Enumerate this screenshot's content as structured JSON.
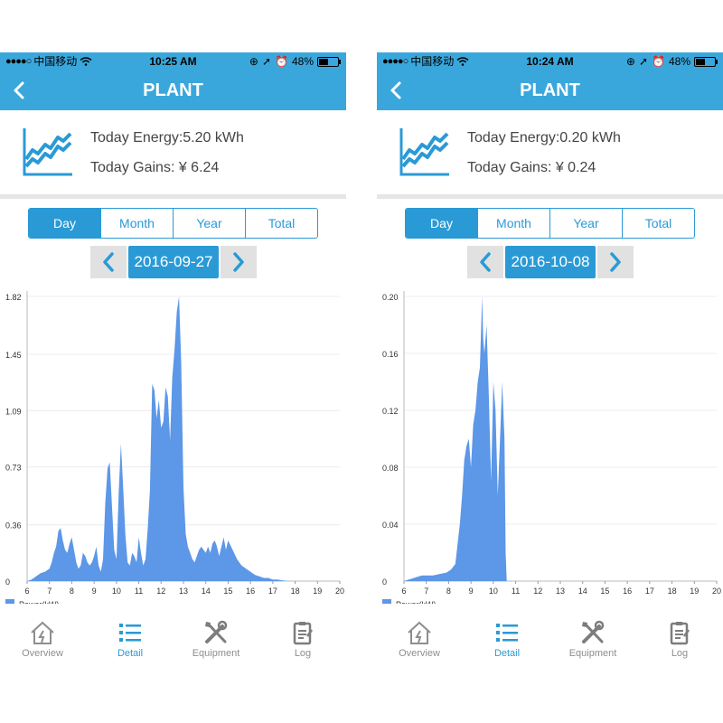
{
  "screens": [
    {
      "status": {
        "carrier": "中国移动",
        "time": "10:25 AM",
        "battery": "48%"
      },
      "nav": {
        "title": "PLANT"
      },
      "summary": {
        "energy": "Today Energy:5.20 kWh",
        "gains": "Today Gains: ¥ 6.24"
      },
      "segments": [
        "Day",
        "Month",
        "Year",
        "Total"
      ],
      "active_segment": 0,
      "date": "2016-09-27",
      "tabs": [
        "Overview",
        "Detail",
        "Equipment",
        "Log"
      ],
      "active_tab": 1
    },
    {
      "status": {
        "carrier": "中国移动",
        "time": "10:24 AM",
        "battery": "48%"
      },
      "nav": {
        "title": "PLANT"
      },
      "summary": {
        "energy": "Today Energy:0.20 kWh",
        "gains": "Today Gains: ¥ 0.24"
      },
      "segments": [
        "Day",
        "Month",
        "Year",
        "Total"
      ],
      "active_segment": 0,
      "date": "2016-10-08",
      "tabs": [
        "Overview",
        "Detail",
        "Equipment",
        "Log"
      ],
      "active_tab": 1
    }
  ],
  "colors": {
    "accent": "#2a9ad6",
    "header": "#3aa7dc",
    "series": "#5c97e8"
  },
  "chart_data": [
    {
      "type": "area",
      "xlabel": "",
      "ylabel": "",
      "x_ticks": [
        "6",
        "7",
        "8",
        "9",
        "10",
        "11",
        "12",
        "13",
        "14",
        "15",
        "16",
        "17",
        "18",
        "19",
        "20"
      ],
      "xlim": [
        6,
        20
      ],
      "y_ticks": [
        "0",
        "0.36",
        "0.73",
        "1.09",
        "1.45",
        "1.82"
      ],
      "ylim": [
        0,
        1.82
      ],
      "series": [
        {
          "name": "Power(kW)",
          "x": [
            6.0,
            6.2,
            6.4,
            6.6,
            6.8,
            7.0,
            7.1,
            7.2,
            7.3,
            7.4,
            7.5,
            7.6,
            7.7,
            7.8,
            7.9,
            8.0,
            8.1,
            8.2,
            8.3,
            8.4,
            8.5,
            8.6,
            8.7,
            8.8,
            8.9,
            9.0,
            9.1,
            9.2,
            9.3,
            9.4,
            9.5,
            9.6,
            9.7,
            9.8,
            9.9,
            10.0,
            10.1,
            10.2,
            10.3,
            10.4,
            10.5,
            10.6,
            10.7,
            10.8,
            10.9,
            11.0,
            11.1,
            11.2,
            11.3,
            11.4,
            11.5,
            11.6,
            11.7,
            11.8,
            11.9,
            12.0,
            12.1,
            12.2,
            12.3,
            12.4,
            12.5,
            12.6,
            12.7,
            12.8,
            12.9,
            13.0,
            13.1,
            13.2,
            13.3,
            13.4,
            13.5,
            13.6,
            13.7,
            13.8,
            13.9,
            14.0,
            14.1,
            14.2,
            14.3,
            14.4,
            14.5,
            14.6,
            14.7,
            14.8,
            14.9,
            15.0,
            15.2,
            15.4,
            15.6,
            15.8,
            16.0,
            16.2,
            16.4,
            16.6,
            16.8,
            17.0,
            17.2,
            17.4,
            17.6,
            17.8,
            18.0,
            18.5,
            19.0,
            19.5,
            20.0
          ],
          "y": [
            0,
            0.01,
            0.03,
            0.05,
            0.06,
            0.08,
            0.12,
            0.18,
            0.22,
            0.32,
            0.34,
            0.26,
            0.2,
            0.18,
            0.24,
            0.28,
            0.2,
            0.12,
            0.08,
            0.1,
            0.18,
            0.16,
            0.12,
            0.1,
            0.12,
            0.16,
            0.22,
            0.1,
            0.06,
            0.14,
            0.5,
            0.72,
            0.76,
            0.48,
            0.2,
            0.14,
            0.56,
            0.88,
            0.6,
            0.3,
            0.12,
            0.1,
            0.18,
            0.16,
            0.12,
            0.28,
            0.18,
            0.1,
            0.14,
            0.34,
            0.58,
            1.26,
            1.22,
            1.04,
            1.16,
            0.98,
            1.02,
            1.24,
            1.18,
            0.9,
            1.3,
            1.48,
            1.72,
            1.82,
            1.4,
            0.6,
            0.3,
            0.22,
            0.18,
            0.14,
            0.12,
            0.16,
            0.2,
            0.22,
            0.2,
            0.18,
            0.22,
            0.18,
            0.24,
            0.26,
            0.22,
            0.16,
            0.22,
            0.28,
            0.2,
            0.26,
            0.2,
            0.14,
            0.1,
            0.08,
            0.06,
            0.04,
            0.03,
            0.02,
            0.02,
            0.01,
            0.01,
            0.005,
            0.002,
            0,
            0,
            0,
            0,
            0,
            0
          ]
        }
      ]
    },
    {
      "type": "area",
      "xlabel": "",
      "ylabel": "",
      "x_ticks": [
        "6",
        "7",
        "8",
        "9",
        "10",
        "11",
        "12",
        "13",
        "14",
        "15",
        "16",
        "17",
        "18",
        "19",
        "20"
      ],
      "xlim": [
        6,
        20
      ],
      "y_ticks": [
        "0",
        "0.04",
        "0.08",
        "0.12",
        "0.16",
        "0.20"
      ],
      "ylim": [
        0,
        0.2
      ],
      "series": [
        {
          "name": "Power(kW)",
          "x": [
            6.0,
            6.2,
            6.4,
            6.6,
            6.8,
            7.0,
            7.3,
            7.6,
            7.9,
            8.1,
            8.3,
            8.5,
            8.6,
            8.7,
            8.8,
            8.9,
            9.0,
            9.1,
            9.2,
            9.3,
            9.4,
            9.5,
            9.55,
            9.6,
            9.7,
            9.8,
            9.9,
            10.0,
            10.1,
            10.2,
            10.3,
            10.4,
            10.5,
            10.55,
            10.6,
            11.0,
            12.0,
            14.0,
            16.0,
            18.0,
            20.0
          ],
          "y": [
            0,
            0.001,
            0.002,
            0.003,
            0.004,
            0.004,
            0.004,
            0.005,
            0.006,
            0.008,
            0.012,
            0.04,
            0.06,
            0.085,
            0.095,
            0.1,
            0.08,
            0.11,
            0.12,
            0.14,
            0.15,
            0.2,
            0.17,
            0.16,
            0.18,
            0.13,
            0.07,
            0.14,
            0.12,
            0.06,
            0.1,
            0.14,
            0.1,
            0.02,
            0,
            0,
            0,
            0,
            0,
            0,
            0
          ]
        }
      ]
    }
  ]
}
